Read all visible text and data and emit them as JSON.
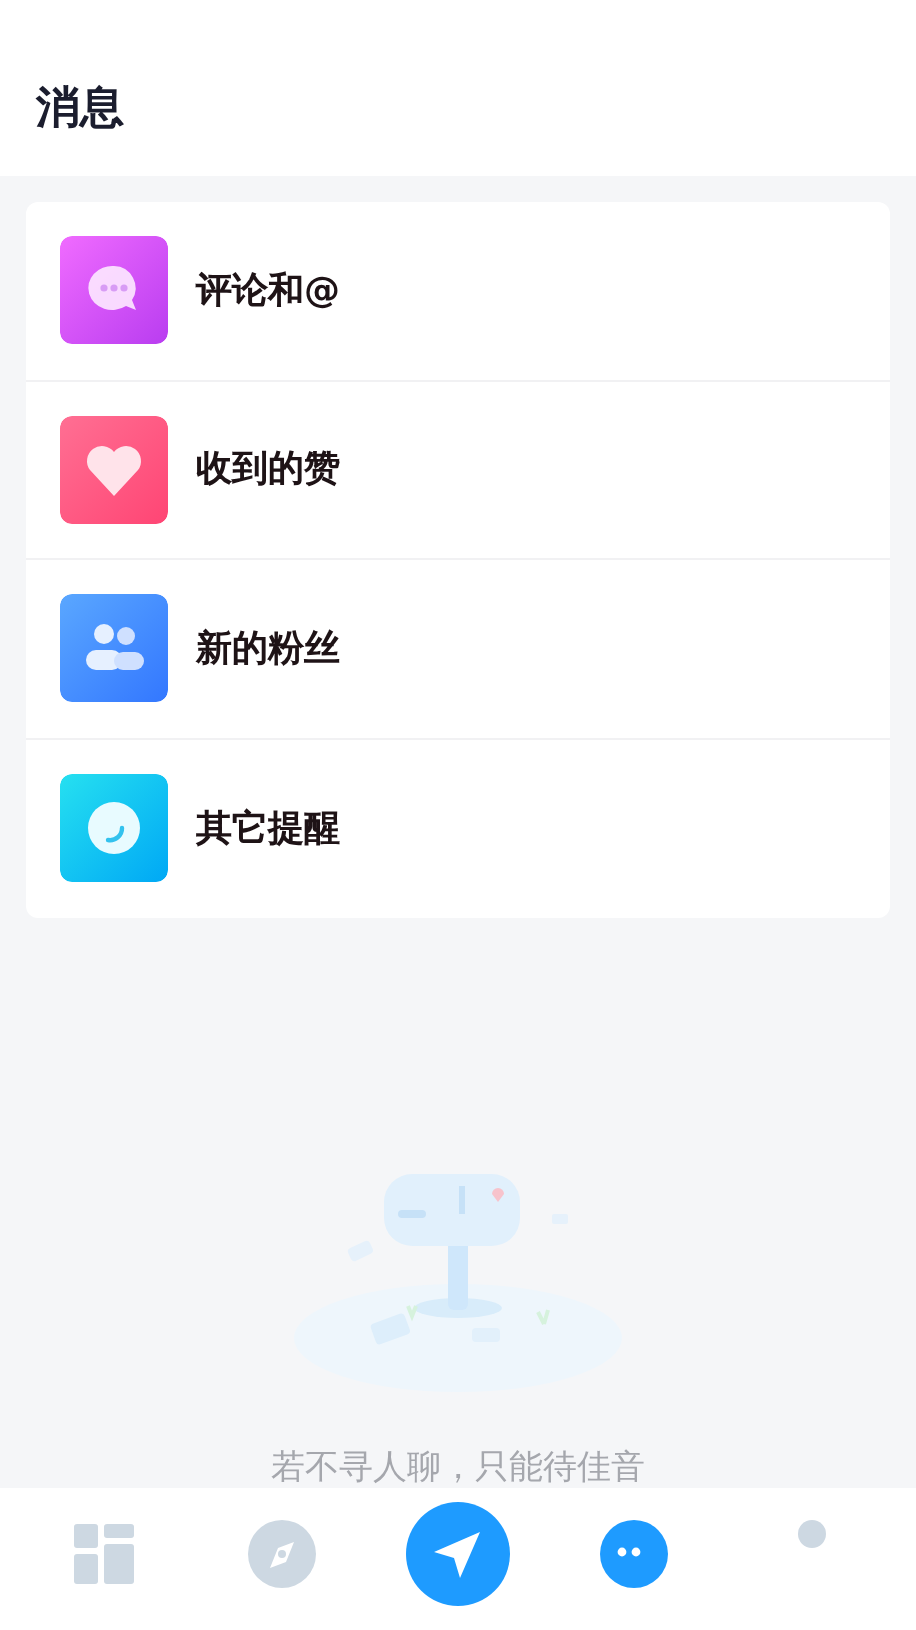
{
  "header": {
    "title": "消息"
  },
  "items": [
    {
      "label": "评论和@",
      "kind": "comment"
    },
    {
      "label": "收到的赞",
      "kind": "like"
    },
    {
      "label": "新的粉丝",
      "kind": "fans"
    },
    {
      "label": "其它提醒",
      "kind": "other"
    }
  ],
  "empty_state": {
    "kind": "picture",
    "text": "若不寻人聊，只能待佳音"
  },
  "tab_bar": {
    "tabs": [
      {
        "kind": "home",
        "selected": false
      },
      {
        "kind": "discover",
        "selected": false
      },
      {
        "kind": "post",
        "selected": false
      },
      {
        "kind": "messages",
        "selected": true
      },
      {
        "kind": "profile",
        "selected": false
      }
    ]
  }
}
